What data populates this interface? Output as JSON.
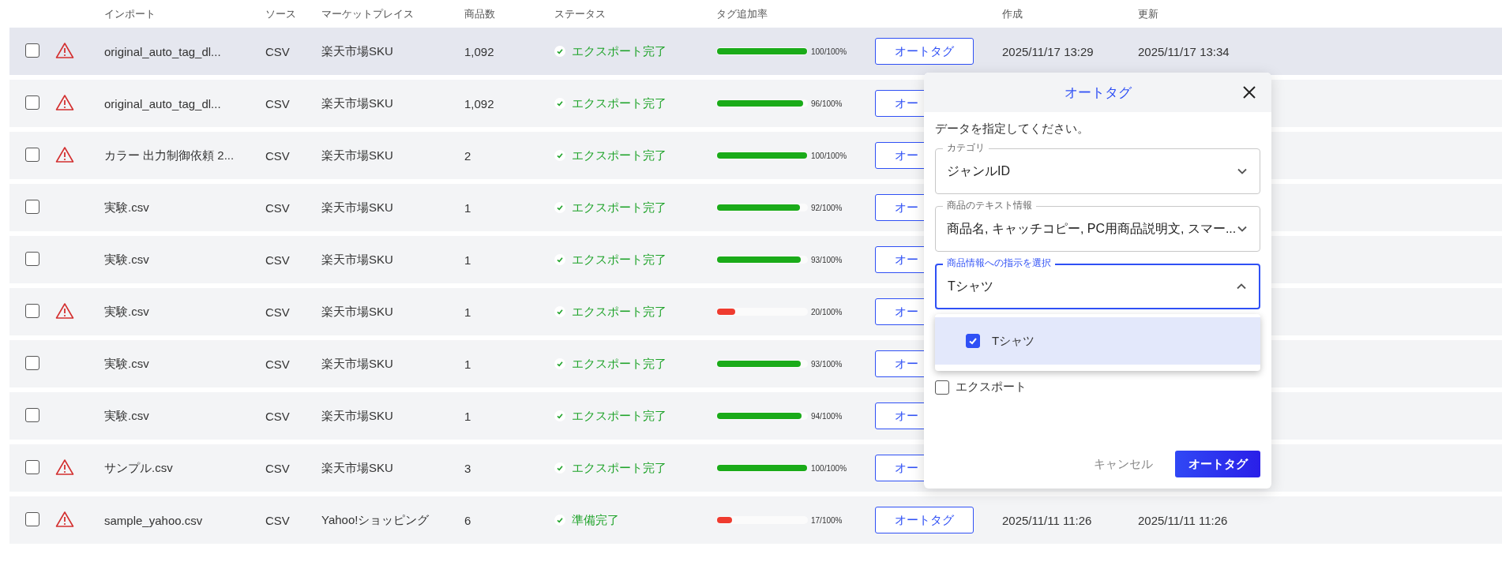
{
  "table": {
    "columns": [
      {
        "label": "インポート"
      },
      {
        "label": "ソース"
      },
      {
        "label": "マーケットプレイス"
      },
      {
        "label": "商品数"
      },
      {
        "label": "ステータス"
      },
      {
        "label": "タグ追加率"
      },
      {
        "label": "作成"
      },
      {
        "label": "更新"
      }
    ],
    "rows": [
      {
        "selected": true,
        "checked": false,
        "warning": true,
        "import": "original_auto_tag_dl...",
        "source": "CSV",
        "marketplace": "楽天市場SKU",
        "count": "1,092",
        "status": "エクスポート完了",
        "level": 1.0,
        "reading": "100/100%",
        "button": "オートタグ",
        "created": "2025/11/17 13:29",
        "updated": "2025/11/17 13:34"
      },
      {
        "selected": false,
        "checked": false,
        "warning": true,
        "import": "original_auto_tag_dl...",
        "source": "CSV",
        "marketplace": "楽天市場SKU",
        "count": "1,092",
        "status": "エクスポート完了",
        "level": 0.96,
        "reading": "96/100%",
        "button": "オー"
      },
      {
        "selected": false,
        "checked": false,
        "warning": true,
        "import": "カラー 出力制御依頼 2...",
        "source": "CSV",
        "marketplace": "楽天市場SKU",
        "count": "2",
        "status": "エクスポート完了",
        "level": 1.0,
        "reading": "100/100%",
        "button": "オー"
      },
      {
        "selected": false,
        "checked": false,
        "warning": false,
        "import": "実験.csv",
        "source": "CSV",
        "marketplace": "楽天市場SKU",
        "count": "1",
        "status": "エクスポート完了",
        "level": 0.92,
        "reading": "92/100%",
        "button": "オー"
      },
      {
        "selected": false,
        "checked": false,
        "warning": false,
        "import": "実験.csv",
        "source": "CSV",
        "marketplace": "楽天市場SKU",
        "count": "1",
        "status": "エクスポート完了",
        "level": 0.93,
        "reading": "93/100%",
        "button": "オー"
      },
      {
        "selected": false,
        "checked": false,
        "warning": true,
        "import": "実験.csv",
        "source": "CSV",
        "marketplace": "楽天市場SKU",
        "count": "1",
        "status": "エクスポート完了",
        "level": 0.2,
        "reading": "20/100%",
        "button": "オー"
      },
      {
        "selected": false,
        "checked": false,
        "warning": false,
        "import": "実験.csv",
        "source": "CSV",
        "marketplace": "楽天市場SKU",
        "count": "1",
        "status": "エクスポート完了",
        "level": 0.93,
        "reading": "93/100%",
        "button": "オー"
      },
      {
        "selected": false,
        "checked": false,
        "warning": false,
        "import": "実験.csv",
        "source": "CSV",
        "marketplace": "楽天市場SKU",
        "count": "1",
        "status": "エクスポート完了",
        "level": 0.94,
        "reading": "94/100%",
        "button": "オー"
      },
      {
        "selected": false,
        "checked": false,
        "warning": true,
        "import": "サンプル.csv",
        "source": "CSV",
        "marketplace": "楽天市場SKU",
        "count": "3",
        "status": "エクスポート完了",
        "level": 1.0,
        "reading": "100/100%",
        "button": "オー"
      },
      {
        "selected": false,
        "checked": false,
        "warning": true,
        "import": "sample_yahoo.csv",
        "source": "CSV",
        "marketplace": "Yahoo!ショッピング",
        "count": "6",
        "status": "準備完了",
        "level": 0.17,
        "reading": "17/100%",
        "button": "オートタグ",
        "created": "2025/11/11 11:26",
        "updated": "2025/11/11 11:26"
      }
    ]
  },
  "dialog": {
    "title": "オートタグ",
    "prompt": "データを指定してください。",
    "fields": [
      {
        "label": "カテゴリ",
        "value": "ジャンルID",
        "expanded": false
      },
      {
        "label": "商品のテキスト情報",
        "value": "商品名, キャッチコピー, PC用商品説明文, スマー...",
        "expanded": false
      },
      {
        "label": "商品情報への指示を選択",
        "value": "Tシャツ",
        "expanded": true,
        "options": [
          {
            "label": "Tシャツ",
            "checked": true,
            "selected": true
          }
        ]
      }
    ],
    "export": {
      "label": "エクスポート",
      "checked": false
    },
    "buttons": {
      "cancel": "キャンセル",
      "submit": "オートタグ"
    }
  }
}
